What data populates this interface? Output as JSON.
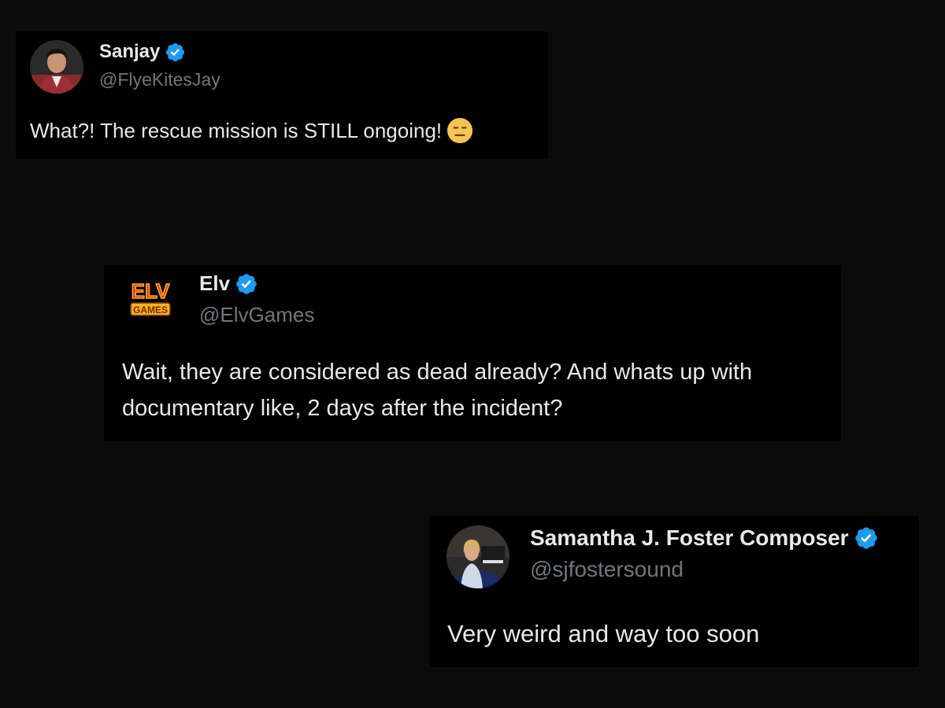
{
  "tweets": [
    {
      "display_name": "Sanjay",
      "handle": "@FlyeKitesJay",
      "text": "What?! The rescue mission is STILL ongoing!",
      "emoji": "expressionless-face-icon",
      "verified": true,
      "avatar": "profile-photo-man-in-red-jacket"
    },
    {
      "display_name": "Elv",
      "handle": "@ElvGames",
      "text": "Wait, they are considered as dead already? And whats up with documentary like, 2 days after the incident?",
      "verified": true,
      "avatar": "elv-games-logo",
      "logo_text_top": "ELV",
      "logo_text_bottom": "GAMES"
    },
    {
      "display_name": "Samantha J. Foster Composer",
      "handle": "@sjfostersound",
      "text": "Very weird and way too soon",
      "verified": true,
      "avatar": "profile-photo-woman-at-piano"
    }
  ],
  "colors": {
    "background": "#0b0b0b",
    "card": "#000000",
    "text": "#e7e9ea",
    "handle": "#71767b",
    "verified": "#1d9bf0"
  }
}
